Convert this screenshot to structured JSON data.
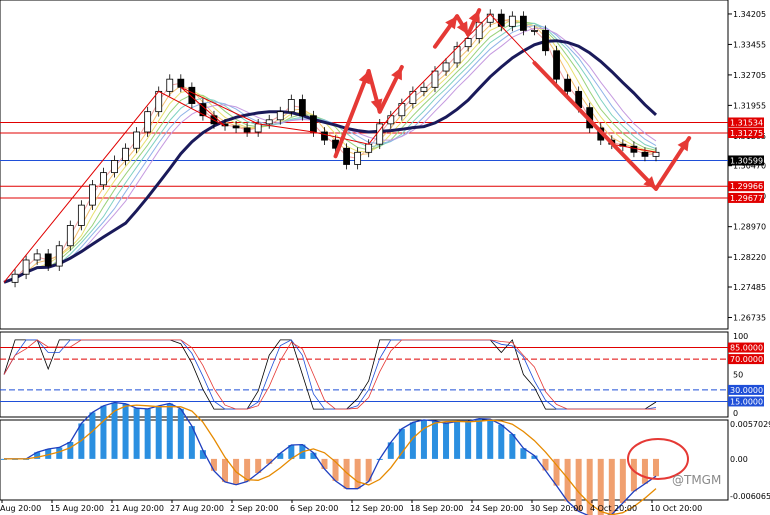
{
  "watermark": "@TMGM",
  "chart_data": [
    {
      "type": "candlestick",
      "panel": "price",
      "x_tick_labels": [
        "Aug 20:00",
        "15 Aug 20:00",
        "21 Aug 20:00",
        "27 Aug 20:00",
        "2 Sep 20:00",
        "6 Sep 20:00",
        "12 Sep 20:00",
        "18 Sep 20:00",
        "24 Sep 20:00",
        "30 Sep 20:00",
        "4 Oct 20:00",
        "10 Oct 20:00"
      ],
      "y_tick_labels": [
        "1.34205",
        "1.33455",
        "1.32705",
        "1.31955",
        "1.31205",
        "1.30470",
        "1.29720",
        "1.28970",
        "1.28220",
        "1.27485",
        "1.26735"
      ],
      "ylim": [
        1.2655,
        1.3445
      ],
      "price_series": [
        1.276,
        1.278,
        1.2815,
        1.283,
        1.28,
        1.285,
        1.29,
        1.295,
        1.3,
        1.303,
        1.306,
        1.309,
        1.313,
        1.318,
        1.323,
        1.326,
        1.324,
        1.32,
        1.317,
        1.315,
        1.3145,
        1.314,
        1.313,
        1.315,
        1.316,
        1.318,
        1.321,
        1.317,
        1.313,
        1.311,
        1.309,
        1.305,
        1.308,
        1.31,
        1.315,
        1.317,
        1.32,
        1.323,
        1.324,
        1.328,
        1.33,
        1.334,
        1.336,
        1.34,
        1.342,
        1.339,
        1.3415,
        1.338,
        1.338,
        1.333,
        1.326,
        1.323,
        1.319,
        1.314,
        1.311,
        1.31,
        1.3095,
        1.308,
        1.307,
        1.308
      ],
      "horizontal_lines": [
        {
          "label": "1.31534",
          "value": 1.31534,
          "color": "#e00000"
        },
        {
          "label": "1.31275",
          "value": 1.31275,
          "color": "#e00000"
        },
        {
          "label": "1.30599",
          "value": 1.30599,
          "color": "#1f4fd8"
        },
        {
          "label": "1.29966",
          "value": 1.29966,
          "color": "#e00000"
        },
        {
          "label": "1.29677",
          "value": 1.29677,
          "color": "#e00000"
        }
      ],
      "current_price_label": "1.30599"
    },
    {
      "type": "line",
      "panel": "stochastic",
      "y_tick_labels": [
        "100",
        "50",
        "0"
      ],
      "ylim": [
        0,
        100
      ],
      "levels": [
        {
          "label": "85.0000",
          "value": 85,
          "color": "#e00000"
        },
        {
          "label": "70.0000",
          "value": 70,
          "color": "#e00000"
        },
        {
          "label": "30.0000",
          "value": 30,
          "color": "#1f4fd8"
        },
        {
          "label": "15.0000",
          "value": 15,
          "color": "#1f4fd8"
        }
      ]
    },
    {
      "type": "bar",
      "panel": "macd",
      "y_tick_labels": [
        "0.0057029",
        "0.00",
        "-0.0060656"
      ],
      "ylim": [
        -0.0060656,
        0.0057029
      ]
    }
  ]
}
